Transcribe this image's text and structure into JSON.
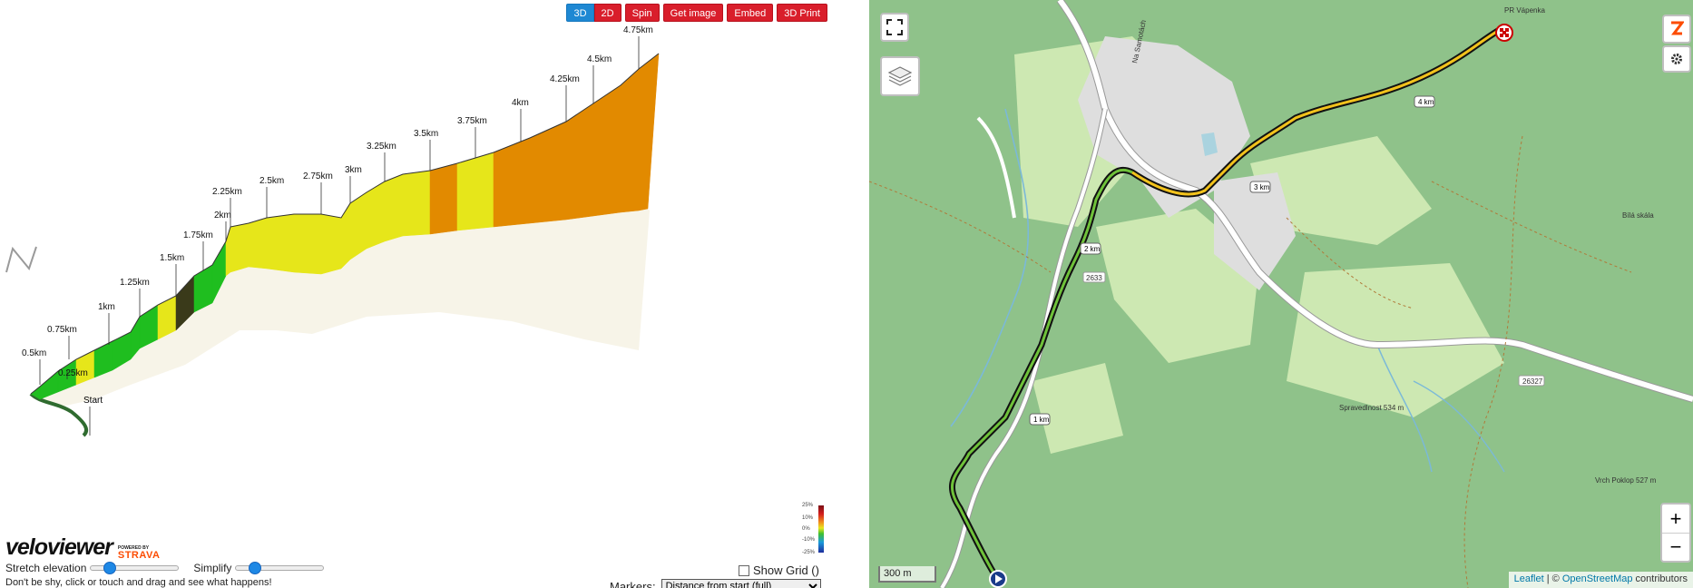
{
  "toolbar": {
    "view_3d": "3D",
    "view_2d": "2D",
    "spin": "Spin",
    "get_image": "Get image",
    "embed": "Embed",
    "print_3d": "3D Print"
  },
  "profile": {
    "start_label": "Start",
    "markers": [
      "0.25km",
      "0.5km",
      "0.75km",
      "1km",
      "1.25km",
      "1.5km",
      "1.75km",
      "2km",
      "2.25km",
      "2.5km",
      "2.75km",
      "3km",
      "3.25km",
      "3.5km",
      "3.75km",
      "4km",
      "4.25km",
      "4.5km",
      "4.75km"
    ],
    "legend": [
      "25%",
      "10%",
      "0%",
      "-10%",
      "-25%"
    ],
    "colors": {
      "green": "#1fbe1f",
      "yellow": "#e6e61a",
      "orange": "#e28a00",
      "dark": "#3a3a1a"
    }
  },
  "brand": {
    "name": "veloviewer",
    "powered_by": "POWERED BY",
    "strava": "STRAVA"
  },
  "controls": {
    "stretch_label": "Stretch elevation",
    "simplify_label": "Simplify",
    "show_grid_label": "Show Grid ()",
    "hint": "Don't be shy, click or touch and drag and see what happens!",
    "markers_label": "Markers:",
    "markers_value": "Distance from start (full)"
  },
  "map": {
    "km_labels": [
      "1 km",
      "2 km",
      "3 km",
      "4 km"
    ],
    "road_labels": [
      "26327",
      "2633",
      "PR Vápenka",
      "Na Samotách"
    ],
    "place_labels": [
      "Spravedlnost 534 m",
      "Vrch Poklop 527 m",
      "Bílá skála"
    ],
    "scale": "300 m",
    "attribution_leaflet": "Leaflet",
    "attribution_sep": " | © ",
    "attribution_osm": "OpenStreetMap",
    "attribution_tail": " contributors",
    "zoom_in": "+",
    "zoom_out": "−"
  }
}
